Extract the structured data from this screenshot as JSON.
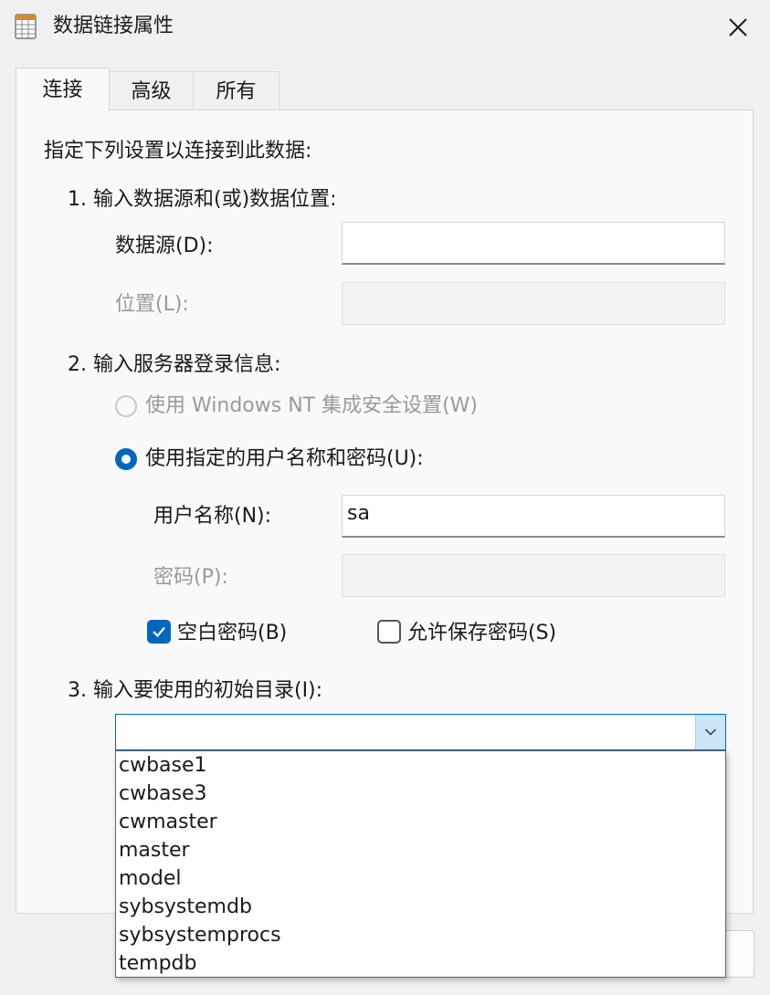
{
  "window": {
    "title": "数据链接属性",
    "icons": {
      "app": "spreadsheet-icon",
      "close": "close-icon"
    }
  },
  "tabs": [
    {
      "label": "连接",
      "active": true
    },
    {
      "label": "高级",
      "active": false
    },
    {
      "label": "所有",
      "active": false
    }
  ],
  "connection": {
    "instruction": "指定下列设置以连接到此数据:",
    "step1": {
      "heading": "1. 输入数据源和(或)数据位置:",
      "data_source_label": "数据源(D):",
      "data_source_value": "",
      "location_label": "位置(L):",
      "location_value": ""
    },
    "step2": {
      "heading": "2. 输入服务器登录信息:",
      "radio_windows_nt": {
        "label": "使用 Windows NT 集成安全设置(W)",
        "selected": false,
        "enabled": false
      },
      "radio_user_password": {
        "label": "使用指定的用户名称和密码(U):",
        "selected": true
      },
      "username_label": "用户名称(N):",
      "username_value": "sa",
      "password_label": "密码(P):",
      "password_value": "",
      "blank_password": {
        "label": "空白密码(B)",
        "checked": true
      },
      "allow_save_password": {
        "label": "允许保存密码(S)",
        "checked": false
      }
    },
    "step3": {
      "heading": "3. 输入要使用的初始目录(I):",
      "catalog_value": "",
      "catalog_options": [
        "cwbase1",
        "cwbase3",
        "cwmaster",
        "master",
        "model",
        "sybsystemdb",
        "sybsystemprocs",
        "tempdb"
      ]
    }
  },
  "colors": {
    "accent": "#0067c0",
    "dropdown_button": "#cce4f7"
  }
}
